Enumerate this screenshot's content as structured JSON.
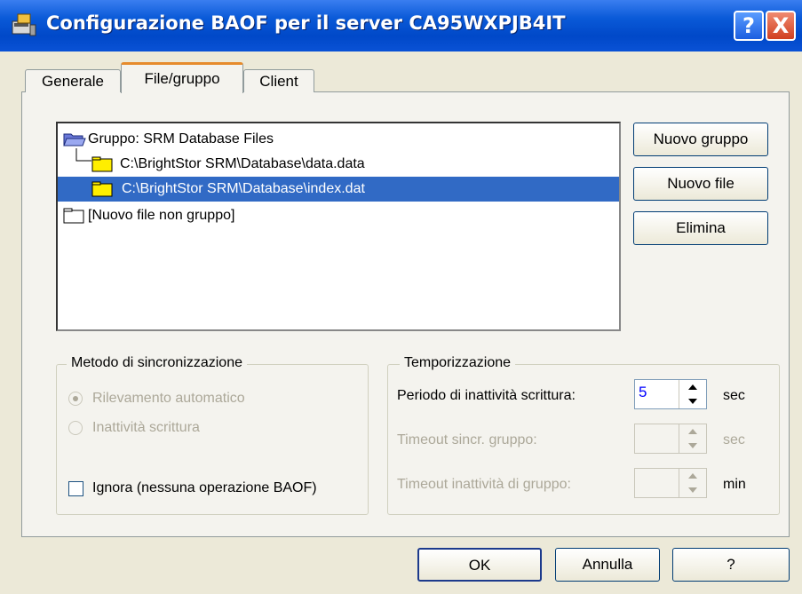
{
  "window": {
    "title": "Configurazione BAOF per il server CA95WXPJB4IT",
    "help_label": "?",
    "close_label": "X"
  },
  "tabs": [
    {
      "label": "Generale",
      "selected": false
    },
    {
      "label": "File/gruppo",
      "selected": true
    },
    {
      "label": "Client",
      "selected": false
    }
  ],
  "tree": {
    "group": "Gruppo: SRM Database Files",
    "files": [
      {
        "label": "C:\\BrightStor SRM\\Database\\data.data",
        "selected": false
      },
      {
        "label": "C:\\BrightStor SRM\\Database\\index.dat",
        "selected": true
      }
    ],
    "ungrouped": "[Nuovo file non gruppo]"
  },
  "side_buttons": {
    "new_group": "Nuovo gruppo",
    "new_file": "Nuovo file",
    "delete": "Elimina"
  },
  "sync": {
    "title": "Metodo di sincronizzazione",
    "auto": "Rilevamento automatico",
    "idle": "Inattività scrittura",
    "ignore": "Ignora (nessuna operazione BAOF)",
    "selected": "auto",
    "ignore_checked": false
  },
  "timing": {
    "title": "Temporizzazione",
    "rows": [
      {
        "label": "Periodo di inattività scrittura:",
        "value": "5",
        "unit": "sec",
        "enabled": true
      },
      {
        "label": "Timeout sincr. gruppo:",
        "value": "",
        "unit": "sec",
        "enabled": false
      },
      {
        "label": "Timeout inattività di gruppo:",
        "value": "",
        "unit": "min",
        "enabled": false
      }
    ]
  },
  "footer": {
    "ok": "OK",
    "cancel": "Annulla",
    "help": "?"
  },
  "colors": {
    "selection": "#316ac5",
    "titlebar": "#0a5ad8",
    "dialog_bg": "#ece9d8"
  }
}
